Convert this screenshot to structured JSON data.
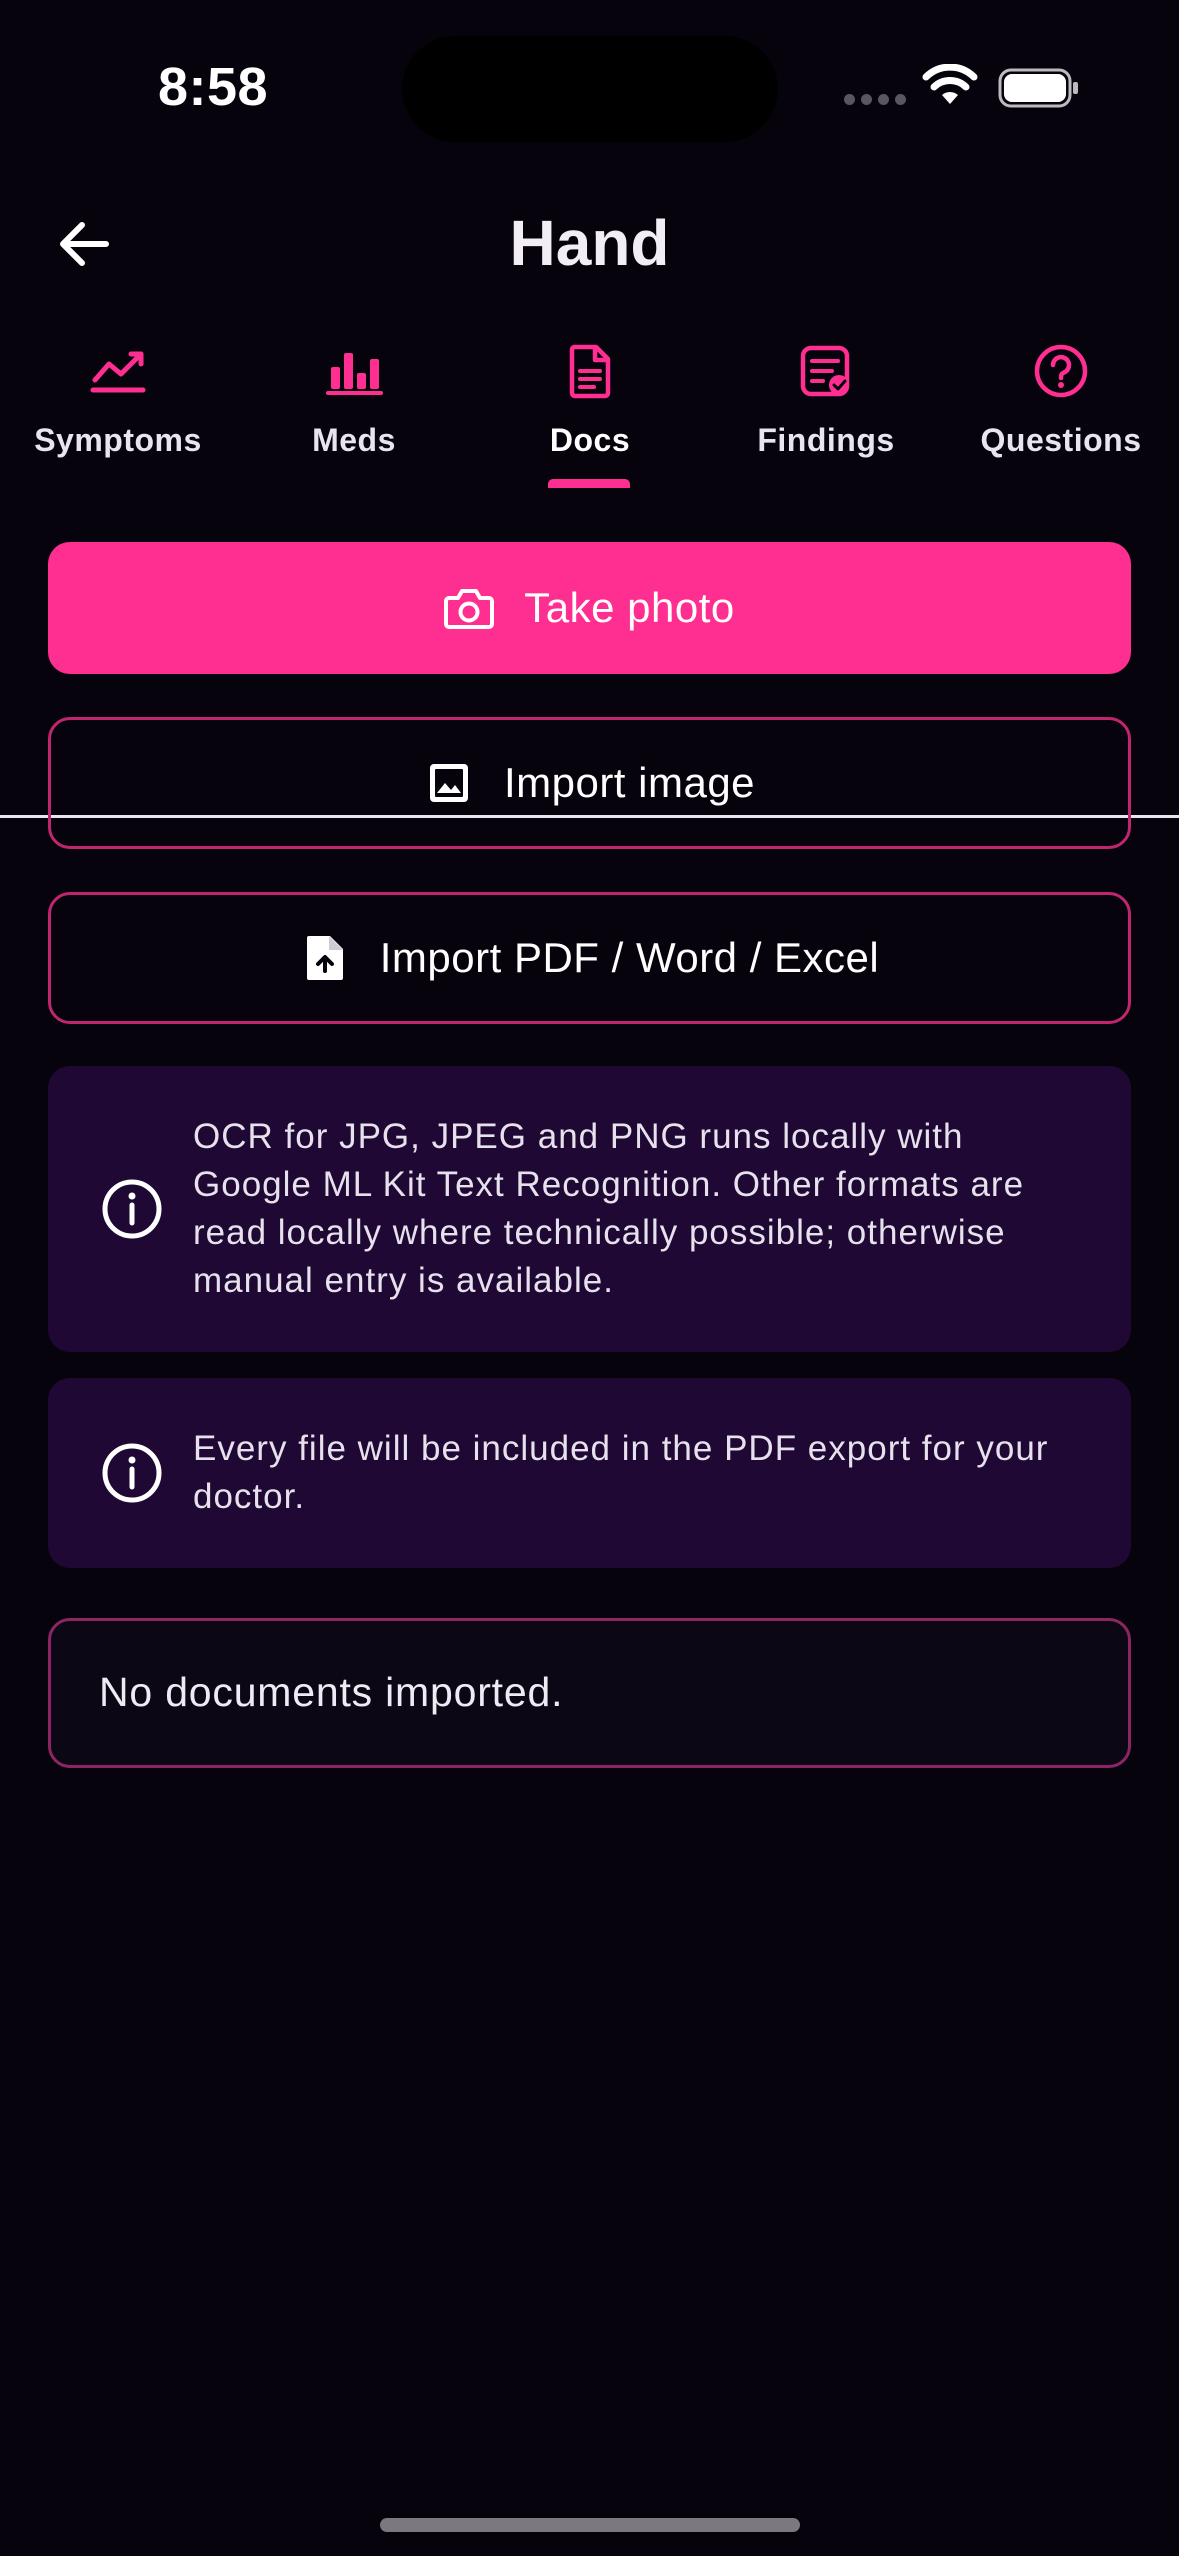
{
  "status_bar": {
    "time": "8:58"
  },
  "header": {
    "title": "Hand",
    "back_icon": "arrow-left-icon"
  },
  "tabs": [
    {
      "label": "Symptoms",
      "icon": "trend-chart-icon",
      "active": false
    },
    {
      "label": "Meds",
      "icon": "bar-chart-icon",
      "active": false
    },
    {
      "label": "Docs",
      "icon": "document-icon",
      "active": true
    },
    {
      "label": "Findings",
      "icon": "clipboard-check-icon",
      "active": false
    },
    {
      "label": "Questions",
      "icon": "question-circle-icon",
      "active": false
    }
  ],
  "actions": {
    "take_photo": "Take photo",
    "import_image": "Import image",
    "import_document": "Import PDF / Word / Excel"
  },
  "info": {
    "ocr": "OCR for JPG, JPEG and PNG runs locally with Google ML Kit Text Recognition. Other formats are read locally where technically possible; otherwise manual entry is available.",
    "export": "Every file will be included in the PDF export for your doctor."
  },
  "documents": {
    "empty_message": "No documents imported."
  },
  "colors": {
    "background": "#07030d",
    "accent": "#ff2f92",
    "outline": "#c0266e",
    "info_card": "#1f0833"
  }
}
